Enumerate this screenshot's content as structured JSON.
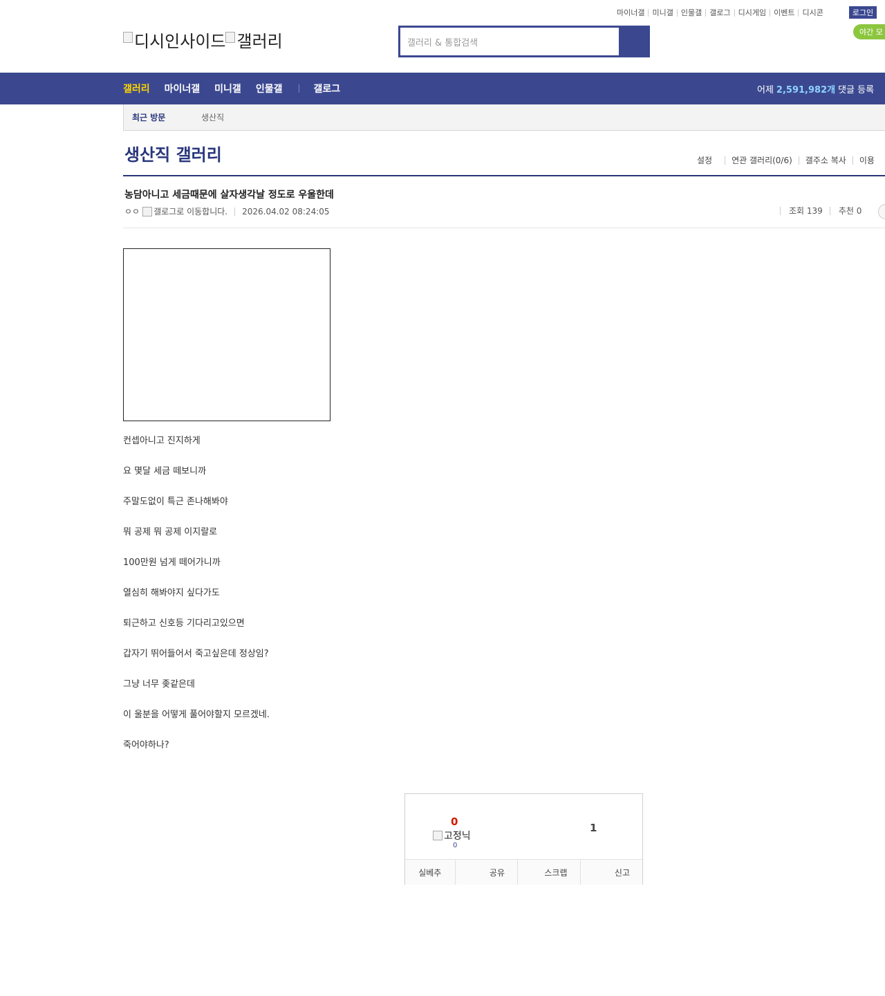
{
  "util_links": [
    "마이너갤",
    "미니갤",
    "인물갤",
    "갤로그",
    "디시게임",
    "이벤트",
    "디시콘"
  ],
  "login_label": "로그인",
  "night_mode_label": "야간 모",
  "logo": {
    "site_alt": "디시인사이드",
    "gallery_alt": "갤러리"
  },
  "search": {
    "placeholder": "갤러리 & 통합검색"
  },
  "gnb": {
    "items": [
      "갤러리",
      "마이너갤",
      "미니갤",
      "인물갤"
    ],
    "extra": "갤로그",
    "stat_prefix": "어제",
    "stat_count": "2,591,982개",
    "stat_suffix": "댓글 등록"
  },
  "recent": {
    "title": "최근 방문",
    "gallery": "생산직"
  },
  "gallery": {
    "title": "생산직 갤러리",
    "options": [
      "설정",
      "연관 갤러리(0/6)",
      "갤주소 복사",
      "이용"
    ]
  },
  "post": {
    "title": "농담아니고 세금때문에 살자생각날 정도로 우울한데",
    "writer": "ㅇㅇ",
    "gallog_alt": "갤로그로 이동합니다.",
    "date": "2026.04.02 08:24:05",
    "views": "조회 139",
    "recommend": "추천 0",
    "lines": [
      "컨셉아니고 진지하게",
      "요 몇달 세금 떼보니까",
      "주말도없이 특근 존나해봐야",
      "뭐 공제 뭐 공제 이지랄로",
      "100만원 넘게 떼어가니까",
      "열심히 해봐야지 싶다가도",
      "퇴근하고 신호등 기다리고있으면",
      "갑자기 뛰어들어서 죽고싶은데 정상임?",
      "그냥 너무 좆같은데",
      "이 울분을 어떻게 풀어야할지 모르겠네.",
      "죽어야하나?"
    ]
  },
  "recommend_box": {
    "up_count": "0",
    "fixed_nick_alt": "고정닉",
    "fixed_count": "0",
    "down_count": "1",
    "actions": [
      "실베추",
      "공유",
      "스크랩",
      "신고"
    ]
  },
  "colors": {
    "brand": "#3b4890",
    "title": "#29367c",
    "highlight": "#ffd600",
    "stat": "#8fd3ff",
    "up": "#d31900",
    "night": "#8cc63f"
  }
}
